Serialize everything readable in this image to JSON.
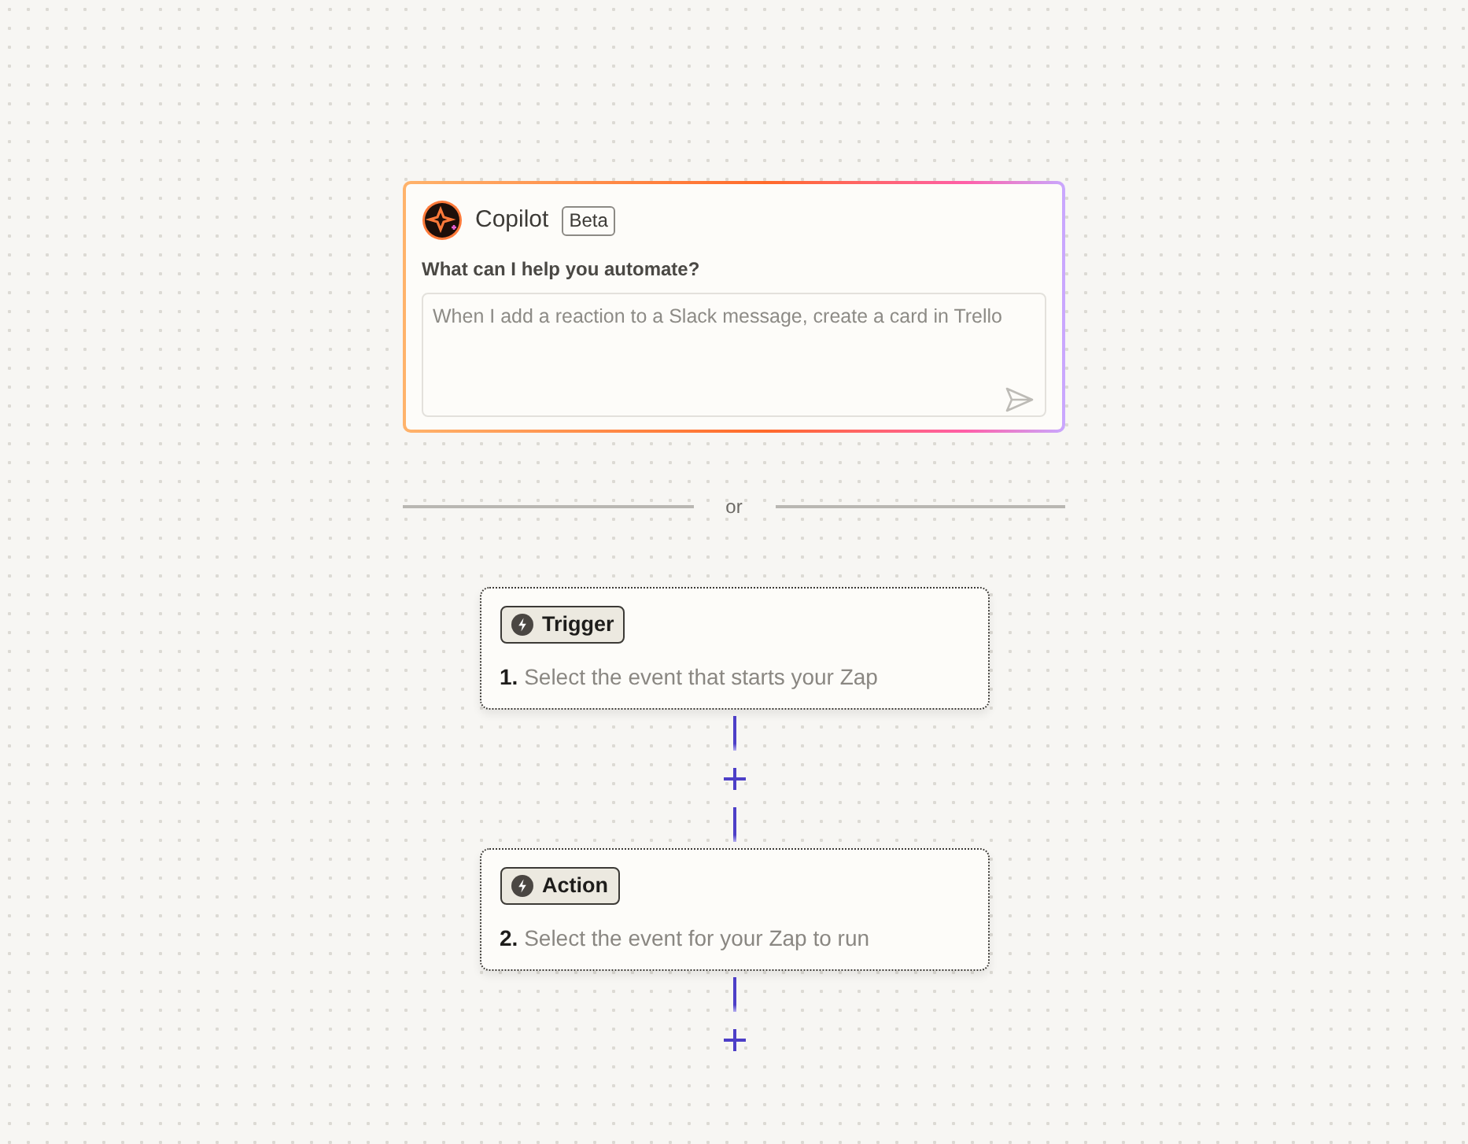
{
  "copilot": {
    "title": "Copilot",
    "badge": "Beta",
    "prompt": "What can I help you automate?",
    "placeholder": "When I add a reaction to a Slack message, create a card in Trello"
  },
  "divider": {
    "label": "or"
  },
  "steps": [
    {
      "tag": "Trigger",
      "text": "**1.** Select the event that starts your Zap"
    },
    {
      "tag": "Action",
      "text": "**2.** Select the event for your Zap to run"
    }
  ]
}
